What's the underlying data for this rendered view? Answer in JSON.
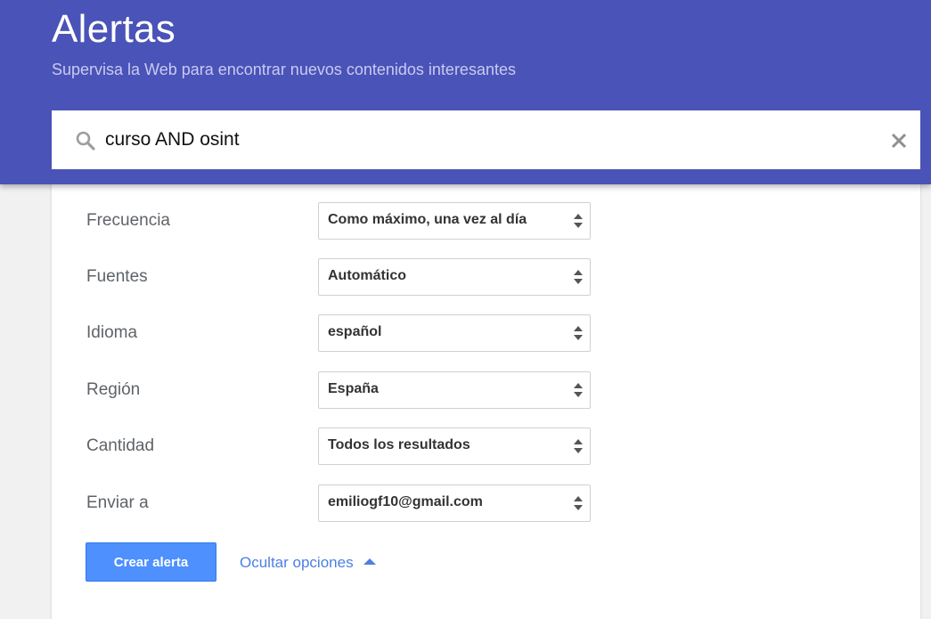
{
  "header": {
    "title": "Alertas",
    "subtitle": "Supervisa la Web para encontrar nuevos contenidos interesantes",
    "accent_color": "#4a53b7"
  },
  "search": {
    "value": "curso AND osint",
    "icon": "search-icon",
    "clear_icon": "close-icon"
  },
  "options": {
    "frequency": {
      "label": "Frecuencia",
      "value": "Como máximo, una vez al día"
    },
    "sources": {
      "label": "Fuentes",
      "value": "Automático"
    },
    "language": {
      "label": "Idioma",
      "value": "español"
    },
    "region": {
      "label": "Región",
      "value": "España"
    },
    "quantity": {
      "label": "Cantidad",
      "value": "Todos los resultados"
    },
    "deliver_to": {
      "label": "Enviar a",
      "value": "emiliogf10@gmail.com"
    }
  },
  "actions": {
    "create_label": "Crear alerta",
    "create_color": "#4d90fe",
    "toggle_options_label": "Ocultar opciones",
    "link_color": "#4d7fe3"
  }
}
